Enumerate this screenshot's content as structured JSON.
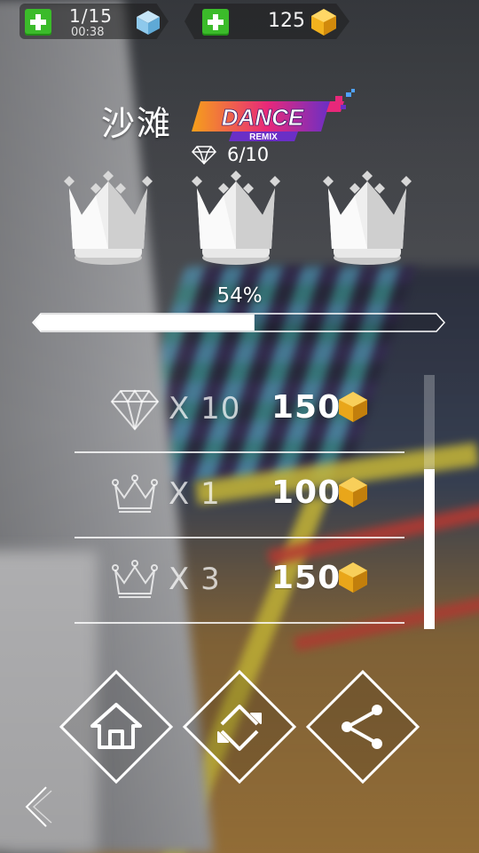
{
  "status_bar": {
    "lives": "1/15",
    "timer": "00:38",
    "gems": "125",
    "add_lives_icon": "plus-icon",
    "lives_icon": "blue-cube-icon",
    "add_gems_icon": "plus-icon",
    "gems_icon": "gold-gem-icon"
  },
  "level": {
    "title": "沙滩",
    "mode_logo": {
      "main": "DANCE",
      "sub": "REMIX"
    },
    "diamonds": "6/10",
    "diamond_icon": "diamond-icon",
    "crowns_earned": 3,
    "crowns_total": 3
  },
  "progress": {
    "label": "54%",
    "value": 0.54
  },
  "rewards": [
    {
      "icon": "diamond-outline-icon",
      "multiplier": "X 10",
      "amount": "150"
    },
    {
      "icon": "crown-outline-icon",
      "multiplier": "X 1",
      "amount": "100"
    },
    {
      "icon": "crown-outline-icon",
      "multiplier": "X 3",
      "amount": "150"
    }
  ],
  "actions": {
    "home": "home-icon",
    "restart": "restart-icon",
    "share": "share-icon",
    "back": "back-arrow-icon"
  },
  "colors": {
    "plus_green": "#3bbb2a",
    "gem_gold": "#f2b21e",
    "cube_blue": "#8ec9ec",
    "remix_pink": "#e8287a",
    "remix_orange": "#f6a01a",
    "remix_purple": "#6a2fc6"
  }
}
